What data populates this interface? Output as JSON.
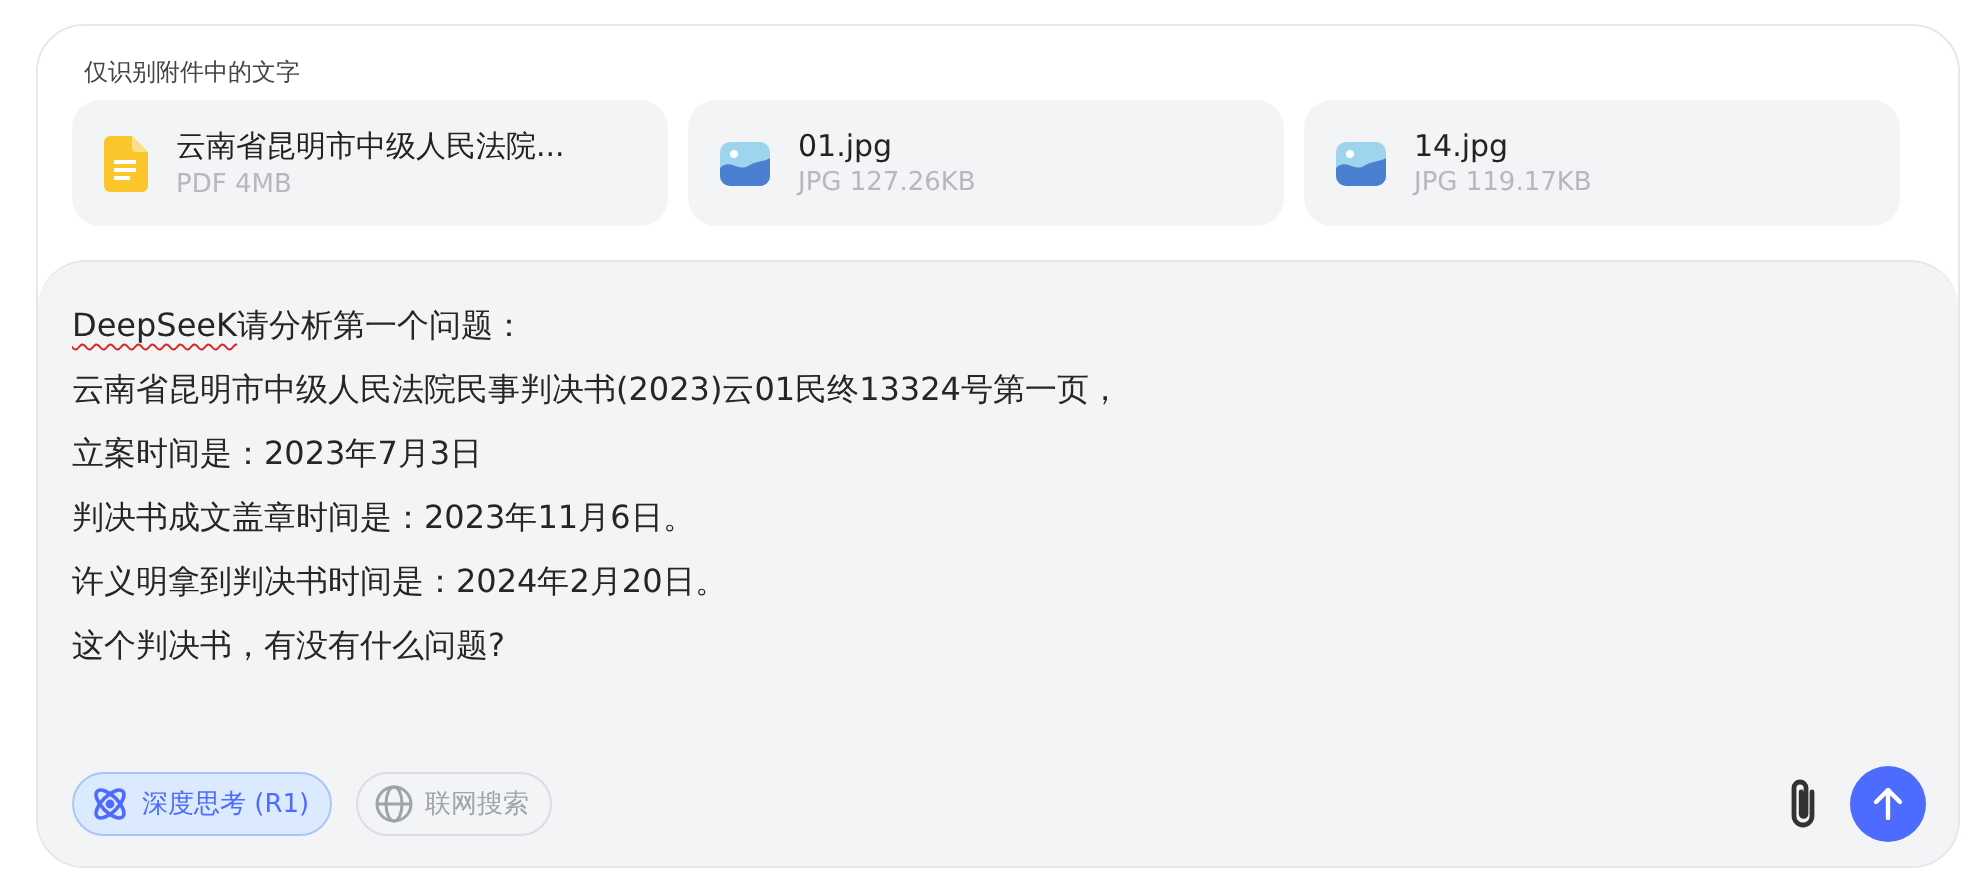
{
  "attachments_hint": "仅识别附件中的文字",
  "attachments": [
    {
      "kind": "document",
      "name": "云南省昆明市中级人民法院...",
      "meta": "PDF 4MB"
    },
    {
      "kind": "image",
      "name": "01.jpg",
      "meta": "JPG 127.26KB"
    },
    {
      "kind": "image",
      "name": "14.jpg",
      "meta": "JPG 119.17KB"
    }
  ],
  "message_lines": [
    [
      {
        "text": "DeepSeeK",
        "misspelled": true
      },
      {
        "text": "请分析第一个问题：",
        "misspelled": false
      }
    ],
    [
      {
        "text": "云南省昆明市中级人民法院民事判决书(2023)云01民终13324号第一页，",
        "misspelled": false
      }
    ],
    [
      {
        "text": "立案时间是：2023年7月3日",
        "misspelled": false
      }
    ],
    [
      {
        "text": "判决书成文盖章时间是：2023年11月6日。",
        "misspelled": false
      }
    ],
    [
      {
        "text": "许义明拿到判决书时间是：2024年2月20日。",
        "misspelled": false
      }
    ],
    [
      {
        "text": "这个判决书，有没有什么问题?",
        "misspelled": false
      }
    ]
  ],
  "toggles": [
    {
      "kind": "deep-think",
      "label": "深度思考 (R1)",
      "selected": true
    },
    {
      "kind": "web-search",
      "label": "联网搜索",
      "selected": false
    }
  ]
}
